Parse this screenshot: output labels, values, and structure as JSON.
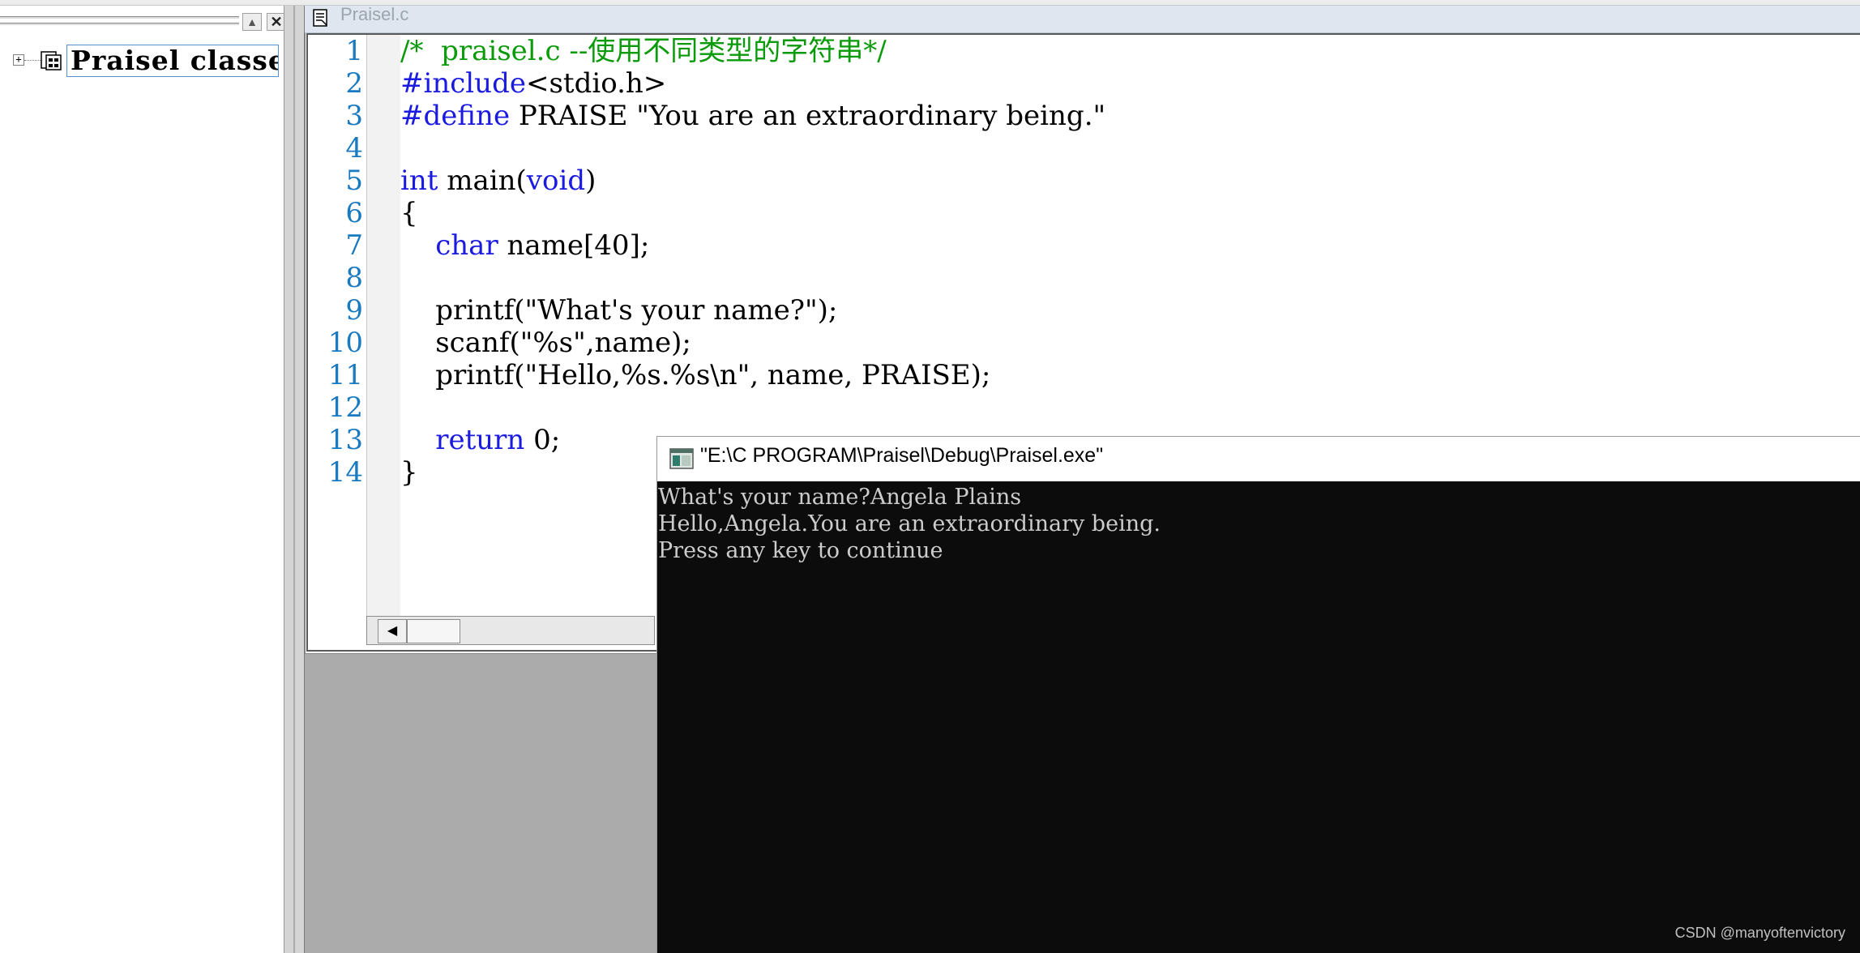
{
  "editor": {
    "title": "Praisel.c",
    "line_numbers": [
      "1",
      "2",
      "3",
      "4",
      "5",
      "6",
      "7",
      "8",
      "9",
      "10",
      "11",
      "12",
      "13",
      "14"
    ],
    "lines": {
      "l1": {
        "comment": "/*  praisel.c --使用不同类型的字符串*/"
      },
      "l2": {
        "kw": "#include",
        "rest": "<stdio.h>"
      },
      "l3": {
        "kw": "#define",
        "rest": " PRAISE \"You are an extraordinary being.\""
      },
      "l4": {
        "text": ""
      },
      "l5": {
        "kw": "int",
        "mid": " main(",
        "kw2": "void",
        "end": ")"
      },
      "l6": {
        "text": "{"
      },
      "l7": {
        "indent": "    ",
        "kw": "char",
        "rest": " name[40];"
      },
      "l8": {
        "text": ""
      },
      "l9": {
        "text": "    printf(\"What's your name?\");"
      },
      "l10": {
        "text": "    scanf(\"%s\",name);"
      },
      "l11": {
        "text": "    printf(\"Hello,%s.%s\\n\", name, PRAISE);"
      },
      "l12": {
        "text": ""
      },
      "l13": {
        "indent": "    ",
        "kw": "return",
        "rest": " 0;"
      },
      "l14": {
        "text": "}"
      }
    },
    "colors": {
      "comment": "#0a9a0a",
      "keyword": "#1a1ae0",
      "line_number": "#1a7ac0"
    }
  },
  "left_pane": {
    "tree_root_label": "Praisel classes",
    "expand_symbol": "+"
  },
  "console": {
    "title": "\"E:\\C PROGRAM\\Praisel\\Debug\\Praisel.exe\"",
    "lines": [
      "What's your name?Angela Plains",
      "Hello,Angela.You are an extraordinary being.",
      "Press any key to continue"
    ],
    "colors": {
      "background": "#0c0c0c",
      "text": "#cccccc"
    }
  },
  "watermark": "CSDN @manyoftenvictory"
}
